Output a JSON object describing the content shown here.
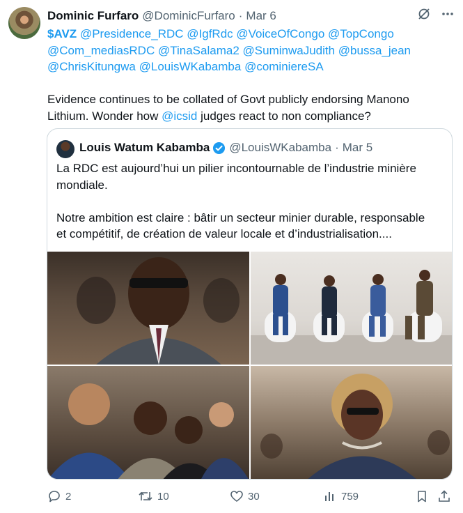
{
  "tweet": {
    "author_name": "Dominic Furfaro",
    "author_handle": "@DominicFurfaro",
    "dot": "·",
    "date": "Mar 6",
    "cashtag": "$AVZ",
    "mentions_line1": [
      "@Presidence_RDC",
      "@IgfRdc",
      "@VoiceOfCongo",
      "@TopCongo"
    ],
    "mentions_line2": [
      "@Com_mediasRDC",
      "@TinaSalama2",
      "@SuminwaJudith",
      "@bussa_jean"
    ],
    "mentions_line3": [
      "@ChrisKitungwa",
      "@LouisWKabamba",
      "@cominiereSA"
    ],
    "text_line1": "Evidence continues to be collated of Govt publicly endorsing Manono",
    "text_line2_pre": "Lithium. Wonder how ",
    "text_line2_mention": "@icsid",
    "text_line2_post": " judges react to non compliance?"
  },
  "quoted": {
    "author_name": "Louis Watum Kabamba",
    "author_handle": "@LouisWKabamba",
    "dot": "·",
    "date": "Mar 5",
    "para1_line1": "La RDC est aujourd’hui un pilier incontournable de l’industrie minière",
    "para1_line2": "mondiale.",
    "para2_line1": "Notre ambition est claire : bâtir un secteur minier durable, responsable",
    "para2_line2": "et compétitif, de création de valeur locale et d’industrialisation...."
  },
  "actions": {
    "replies": "2",
    "reposts": "10",
    "likes": "30",
    "views": "759"
  },
  "icons": {
    "header": [
      "grok-icon",
      "more-icon"
    ],
    "actions": [
      "reply-icon",
      "repost-icon",
      "like-icon",
      "views-icon",
      "bookmark-icon",
      "share-icon"
    ],
    "verified": "verified-badge-icon"
  },
  "colors": {
    "link": "#1d9bf0",
    "muted": "#536471",
    "text": "#0f1419",
    "border": "#cfd9de"
  }
}
